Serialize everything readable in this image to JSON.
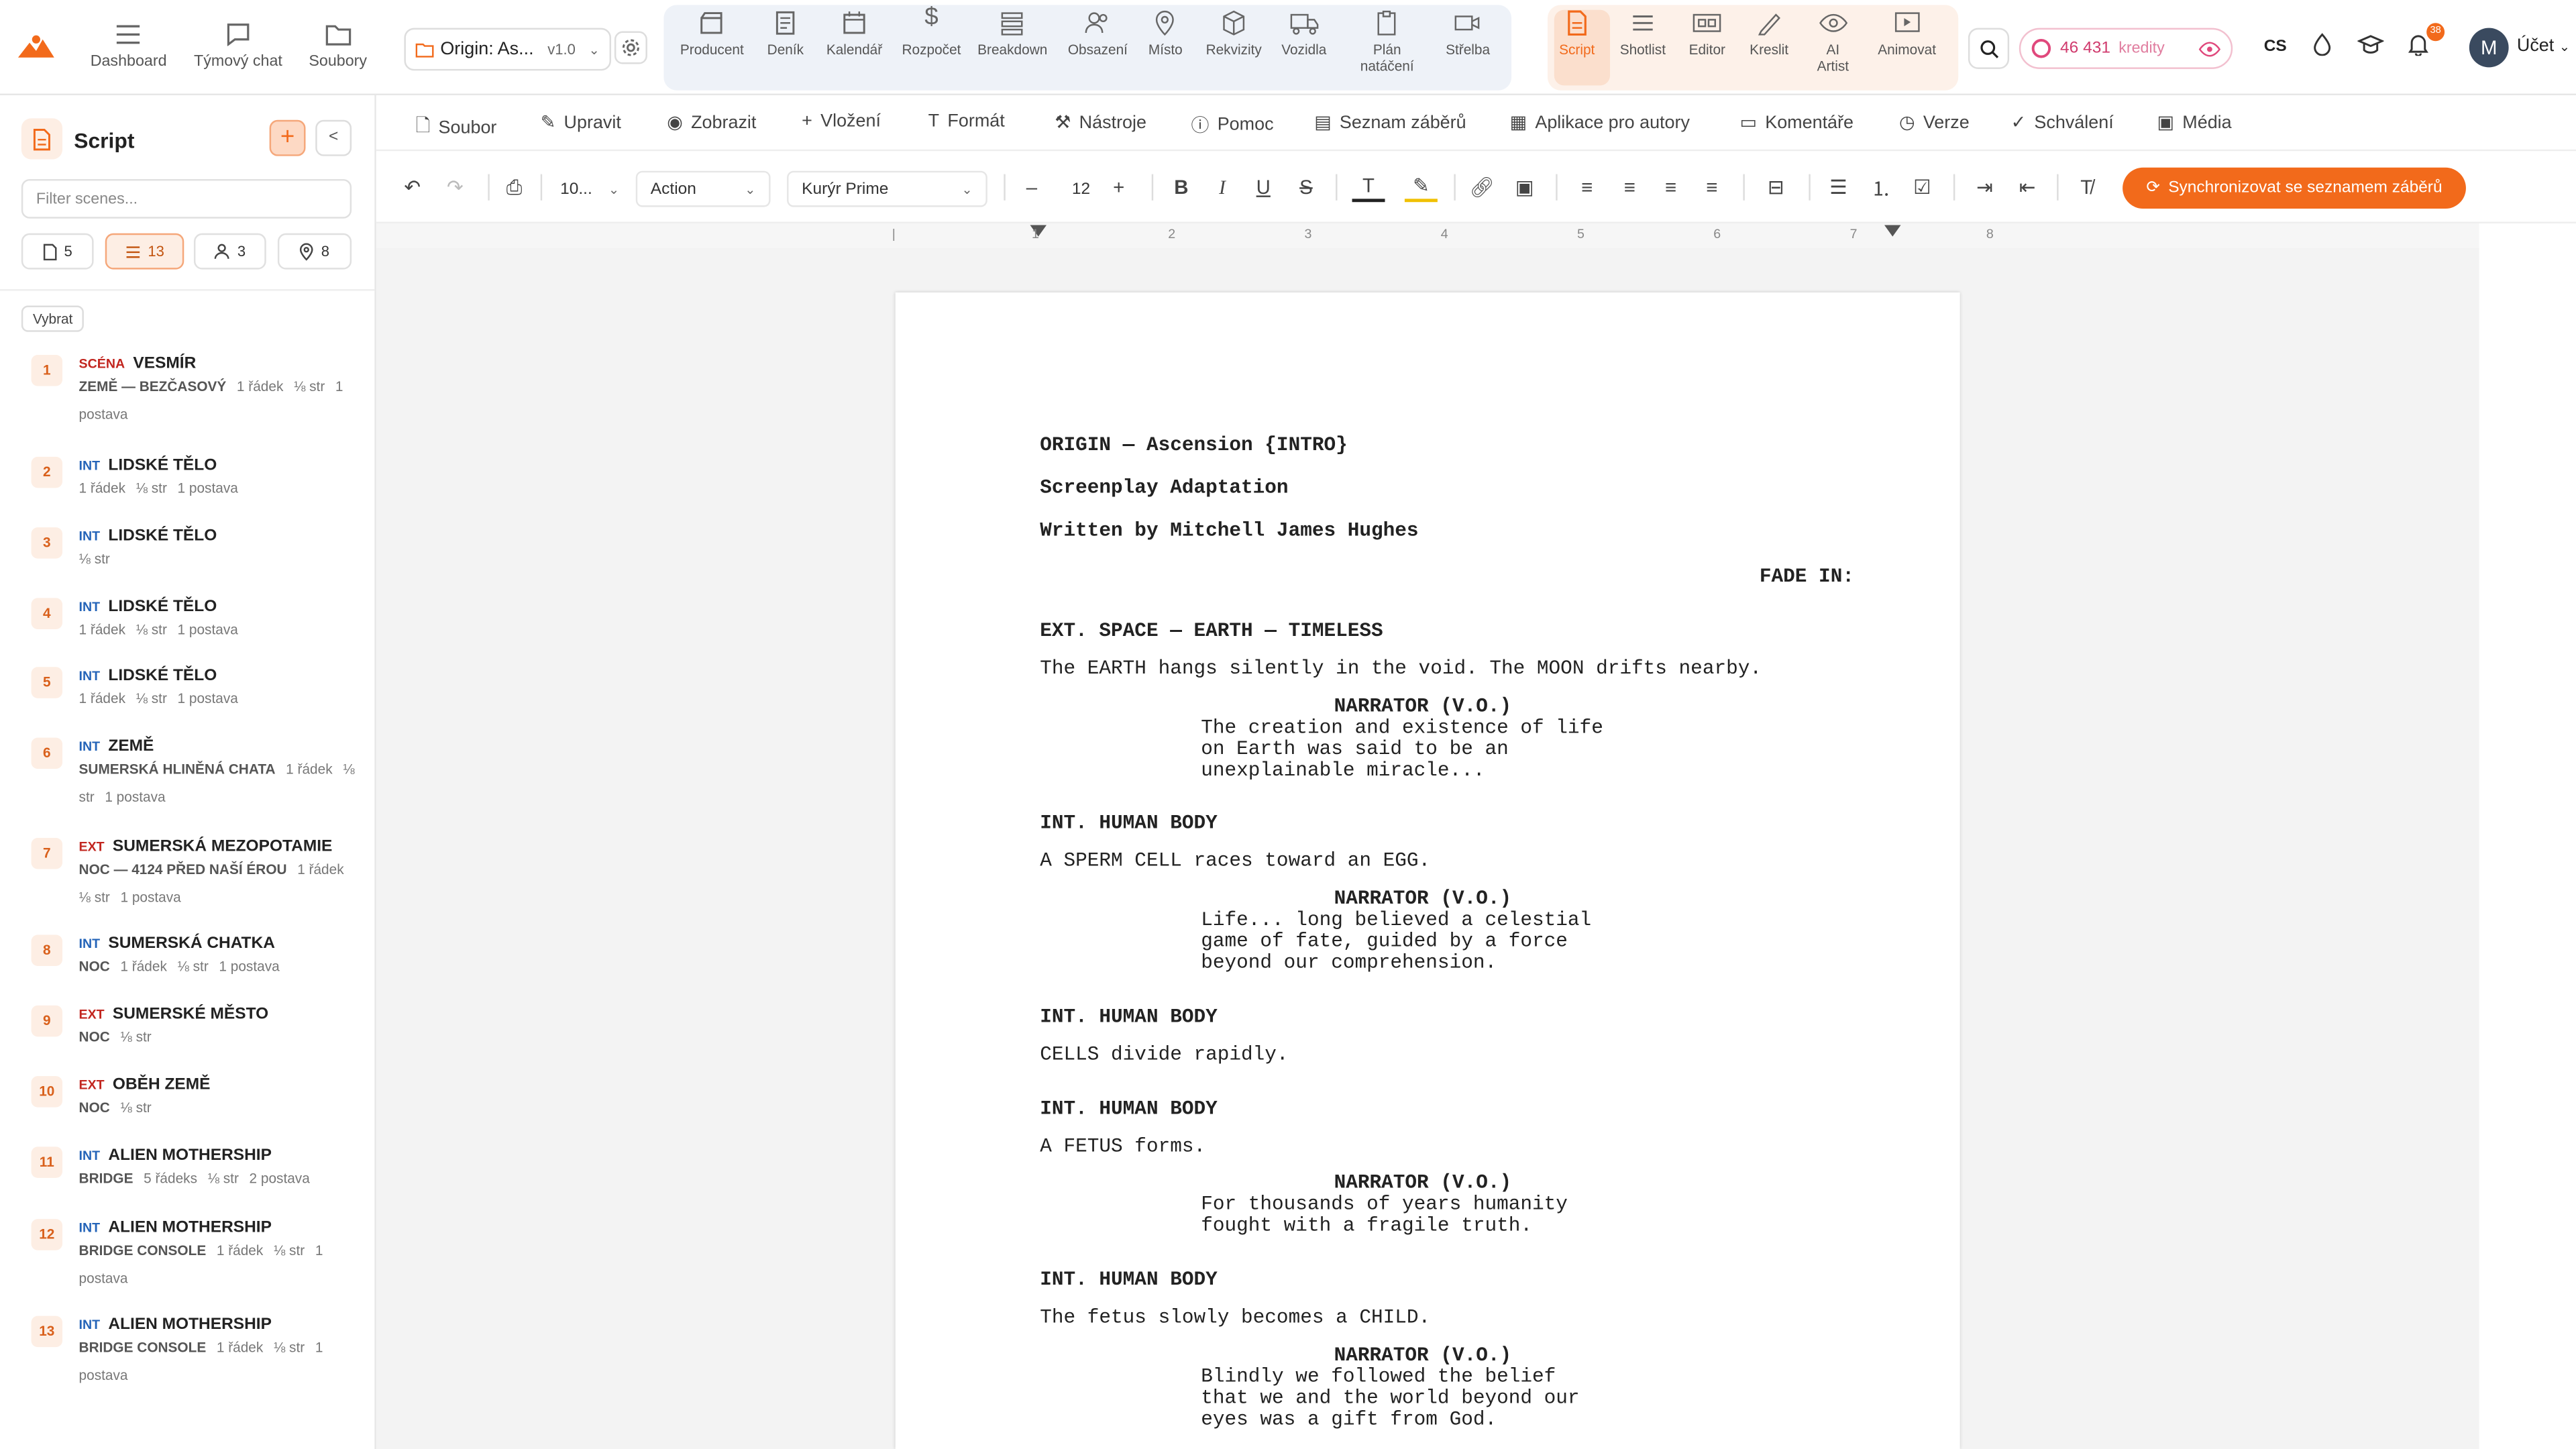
{
  "nav": {
    "dashboard": "Dashboard",
    "team_chat": "Týmový chat",
    "files": "Soubory",
    "project_name": "Origin: As...",
    "project_version": "v1.0"
  },
  "modules": {
    "producent": "Producent",
    "denik": "Deník",
    "kalendar": "Kalendář",
    "rozpocet": "Rozpočet",
    "breakdown": "Breakdown",
    "obsazeni": "Obsazení",
    "misto": "Místo",
    "rekvizity": "Rekvizity",
    "vozidla": "Vozidla",
    "plan1": "Plán",
    "plan2": "natáčení",
    "strelba": "Střelba",
    "script": "Script",
    "shotlist": "Shotlist",
    "editor": "Editor",
    "kreslit": "Kreslit",
    "ai1": "AI",
    "ai2": "Artist",
    "animovat": "Animovat"
  },
  "account": {
    "credits_value": "46 431",
    "credits_label": "kredity",
    "lang": "CS",
    "notif_count": "38",
    "avatar_initial": "M",
    "account_label": "Účet"
  },
  "sidebar": {
    "title": "Script",
    "filter_placeholder": "Filter scenes...",
    "chips": [
      "5",
      "13",
      "3",
      "8"
    ],
    "select_label": "Vybrat",
    "scenes": [
      {
        "num": "1",
        "tag": "SCÉNA",
        "title": "VESMÍR",
        "sub": "ZEMĚ — BEZČASOVÝ",
        "m1": "1 řádek",
        "m2": "⅛ str",
        "m3": "1 postava"
      },
      {
        "num": "2",
        "tag": "INT",
        "title": "LIDSKÉ TĚLO",
        "sub": "",
        "m1": "1 řádek",
        "m2": "⅛ str",
        "m3": "1 postava"
      },
      {
        "num": "3",
        "tag": "INT",
        "title": "LIDSKÉ TĚLO",
        "sub": "",
        "m1": "",
        "m2": "⅛ str",
        "m3": ""
      },
      {
        "num": "4",
        "tag": "INT",
        "title": "LIDSKÉ TĚLO",
        "sub": "",
        "m1": "1 řádek",
        "m2": "⅛ str",
        "m3": "1 postava"
      },
      {
        "num": "5",
        "tag": "INT",
        "title": "LIDSKÉ TĚLO",
        "sub": "",
        "m1": "1 řádek",
        "m2": "⅛ str",
        "m3": "1 postava"
      },
      {
        "num": "6",
        "tag": "INT",
        "title": "ZEMĚ",
        "sub": "SUMERSKÁ HLINĚNÁ CHATA",
        "m1": "1 řádek",
        "m2": "⅛ str",
        "m3": "1 postava"
      },
      {
        "num": "7",
        "tag": "EXT",
        "title": "SUMERSKÁ MEZOPOTAMIE",
        "sub": "NOC — 4124 PŘED NAŠÍ ÉROU",
        "m1": "1 řádek",
        "m2": "⅛ str",
        "m3": "1 postava"
      },
      {
        "num": "8",
        "tag": "INT",
        "title": "SUMERSKÁ CHATKA",
        "sub": "NOC",
        "m1": "1 řádek",
        "m2": "⅛ str",
        "m3": "1 postava"
      },
      {
        "num": "9",
        "tag": "EXT",
        "title": "SUMERSKÉ MĚSTO",
        "sub": "NOC",
        "m1": "",
        "m2": "⅛ str",
        "m3": ""
      },
      {
        "num": "10",
        "tag": "EXT",
        "title": "OBĚH ZEMĚ",
        "sub": "NOC",
        "m1": "",
        "m2": "⅛ str",
        "m3": ""
      },
      {
        "num": "11",
        "tag": "INT",
        "title": "ALIEN MOTHERSHIP",
        "sub": "BRIDGE",
        "m1": "5 řádeks",
        "m2": "⅛ str",
        "m3": "2 postava"
      },
      {
        "num": "12",
        "tag": "INT",
        "title": "ALIEN MOTHERSHIP",
        "sub": "BRIDGE CONSOLE",
        "m1": "1 řádek",
        "m2": "⅛ str",
        "m3": "1 postava"
      },
      {
        "num": "13",
        "tag": "INT",
        "title": "ALIEN MOTHERSHIP",
        "sub": "BRIDGE CONSOLE",
        "m1": "1 řádek",
        "m2": "⅛ str",
        "m3": "1 postava"
      }
    ]
  },
  "menu": {
    "soubor": "Soubor",
    "upravit": "Upravit",
    "zobrazit": "Zobrazit",
    "vlozeni": "Vložení",
    "format": "Formát",
    "nastroje": "Nástroje",
    "pomoc": "Pomoc",
    "seznam": "Seznam záběrů",
    "aplikace": "Aplikace pro autory",
    "komentare": "Komentáře",
    "verze": "Verze",
    "schvaleni": "Schválení",
    "media": "Média"
  },
  "toolbar": {
    "zoom": "10...",
    "element_type": "Action",
    "font": "Kurýr Prime",
    "font_size": "12",
    "sync_label": "Synchronizovat se seznamem záběrů"
  },
  "ruler": [
    "1",
    "2",
    "3",
    "4",
    "5",
    "6",
    "7",
    "8"
  ],
  "script": {
    "title": "ORIGIN — Ascension {INTRO}",
    "subtitle": "Screenplay Adaptation",
    "byline": "Written by Mitchell James Hughes",
    "fade_in": "FADE IN:",
    "h1": "EXT. SPACE — EARTH — TIMELESS",
    "a1": "The EARTH hangs silently in the void. The MOON drifts nearby.",
    "c1": "NARRATOR (V.O.)",
    "d1": "The creation and existence of life\non Earth was said to be an\nunexplainable miracle...",
    "h2": "INT. HUMAN BODY",
    "a2": "A SPERM CELL races toward an EGG.",
    "c2": "NARRATOR (V.O.)",
    "d2": "Life... long believed a celestial\ngame of fate, guided by a force\nbeyond our comprehension.",
    "h3": "INT. HUMAN BODY",
    "a3": "CELLS divide rapidly.",
    "h4": "INT. HUMAN BODY",
    "a4": "A FETUS forms.",
    "c4": "NARRATOR (V.O.)",
    "d4": "For thousands of years humanity\nfought with a fragile truth.",
    "h5": "INT. HUMAN BODY",
    "a5": "The fetus slowly becomes a CHILD.",
    "c5": "NARRATOR (V.O.)",
    "d5": "Blindly we followed the belief\nthat we and the world beyond our\neyes was a gift from God."
  },
  "colors": {
    "accent": "#f26a1b",
    "int_tag": "#2464b8",
    "ext_tag": "#c2261f"
  }
}
